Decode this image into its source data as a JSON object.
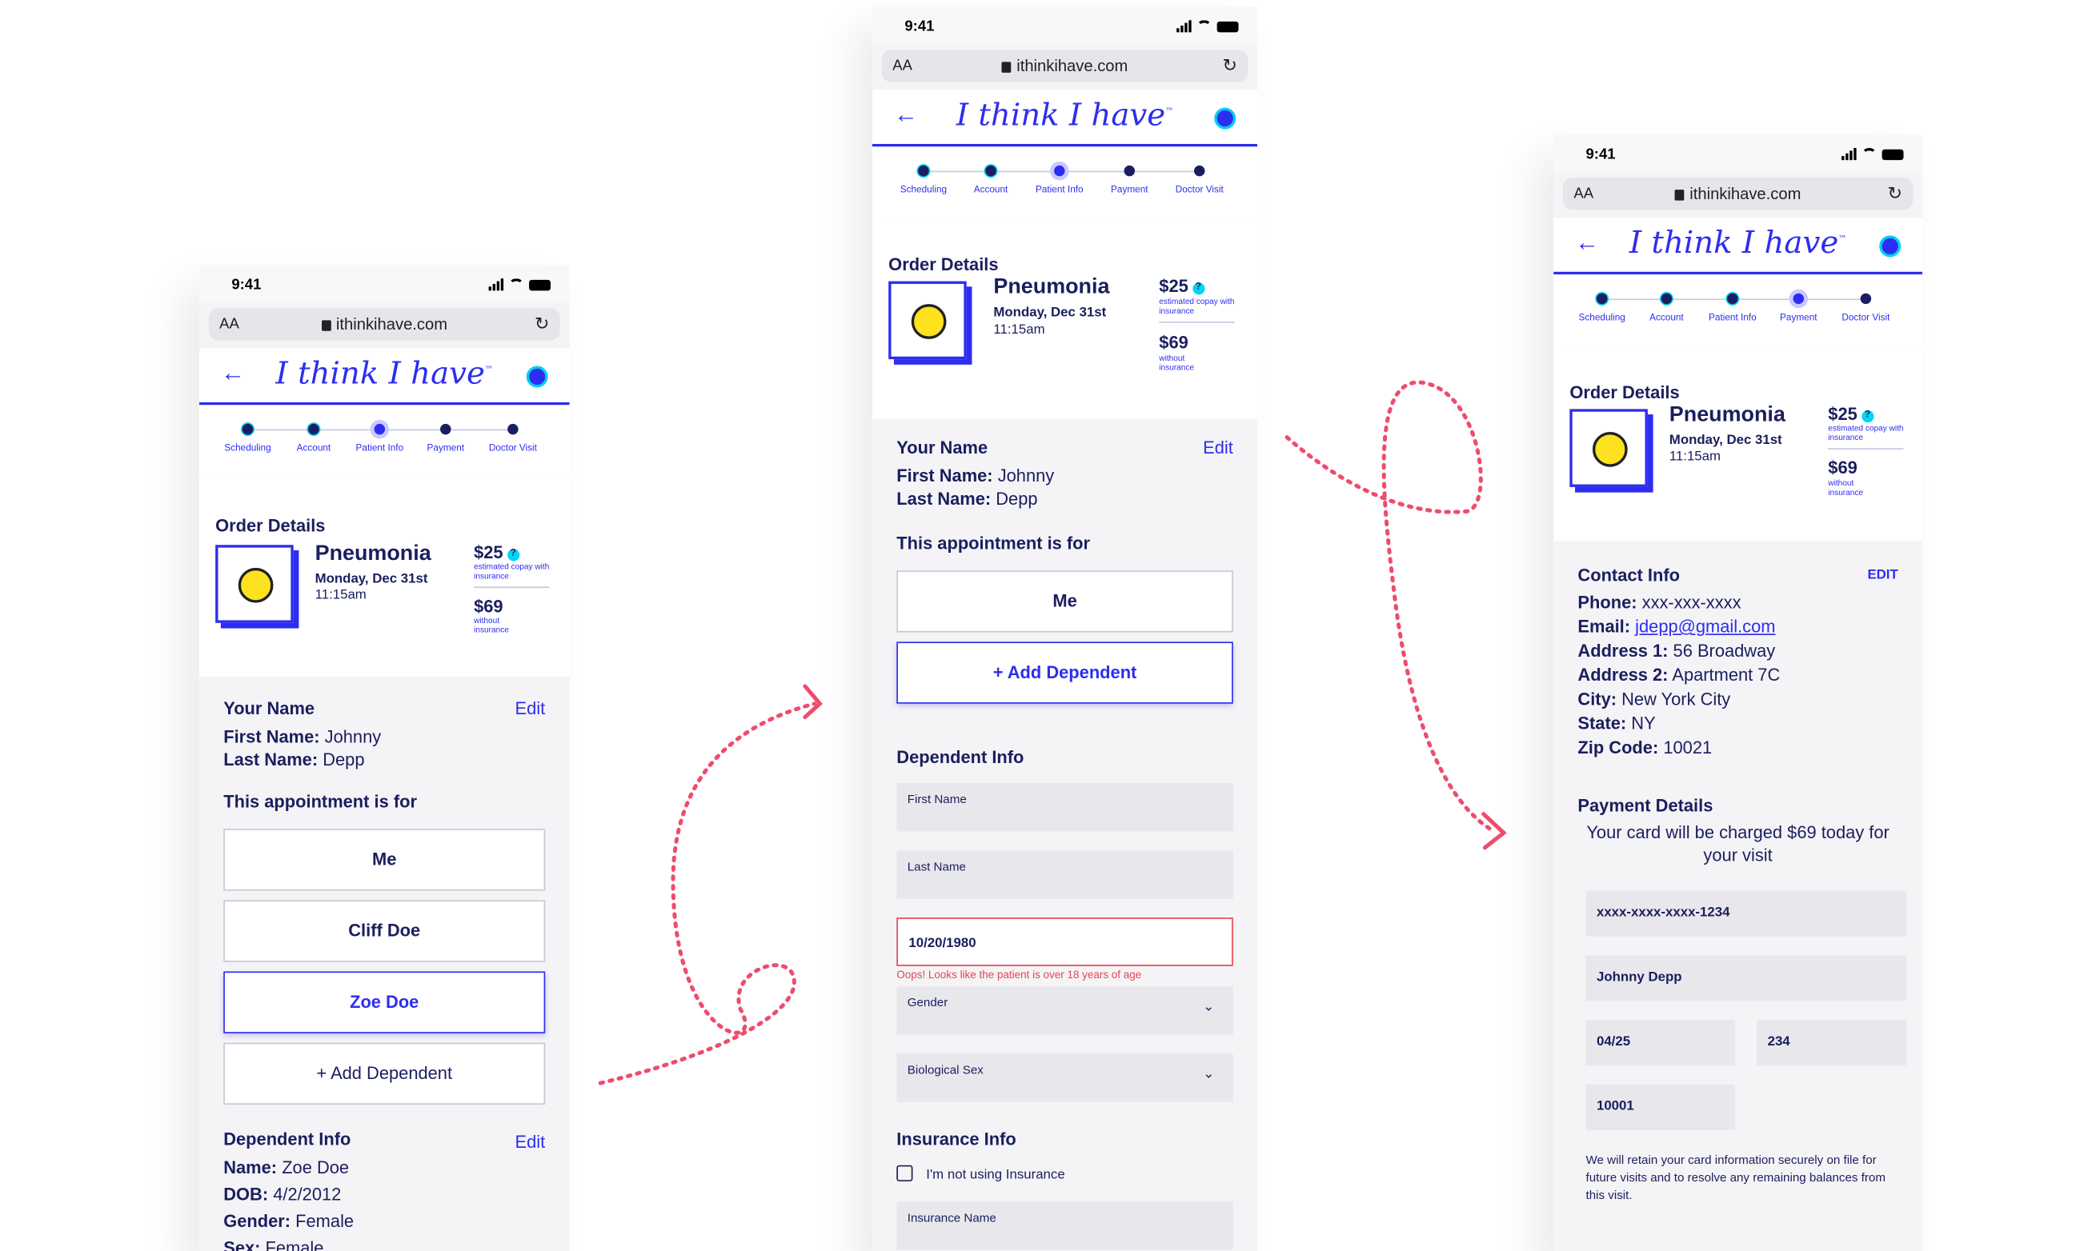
{
  "colors": {
    "accent": "#2d2df0",
    "navy": "#1b1e5e",
    "error": "#e8454e",
    "arrow": "#ef4b6e",
    "highlight": "#00d5f5"
  },
  "common": {
    "time": "9:41",
    "aa": "AA",
    "url": "ithinkihave.com",
    "logo": "I think I have",
    "tm": "™",
    "steps": [
      "Scheduling",
      "Account",
      "Patient Info",
      "Payment",
      "Doctor Visit"
    ],
    "order": {
      "title": "Order Details",
      "condition": "Pneumonia",
      "date": "Monday, Dec 31st",
      "time": "11:15am",
      "price_insured": "$25",
      "price_insured_note": "estimated copay with insurance",
      "price_uninsured": "$69",
      "price_uninsured_note": "without insurance",
      "help": "?"
    }
  },
  "left": {
    "your_name": "Your Name",
    "edit": "Edit",
    "first_label": "First Name:",
    "first_value": "Johnny",
    "last_label": "Last Name:",
    "last_value": "Depp",
    "appt_for": "This appointment is for",
    "options": [
      "Me",
      "Cliff Doe",
      "Zoe Doe",
      "+ Add Dependent"
    ],
    "dependent_title": "Dependent Info",
    "dep_edit": "Edit",
    "dep": [
      {
        "label": "Name:",
        "value": "Zoe Doe"
      },
      {
        "label": "DOB:",
        "value": "4/2/2012"
      },
      {
        "label": "Gender:",
        "value": "Female"
      },
      {
        "label": "Sex:",
        "value": "Female"
      }
    ]
  },
  "middle": {
    "your_name": "Your Name",
    "edit": "Edit",
    "first_label": "First Name:",
    "first_value": "Johnny",
    "last_label": "Last Name:",
    "last_value": "Depp",
    "appt_for": "This appointment is for",
    "options": [
      "Me",
      "+ Add Dependent"
    ],
    "dependent_title": "Dependent Info",
    "first_name_label": "First Name",
    "last_name_label": "Last Name",
    "dob_value": "10/20/1980",
    "dob_error": "Oops! Looks like the patient is over 18 years of age",
    "gender_label": "Gender",
    "sex_label": "Biological Sex",
    "insurance_title": "Insurance Info",
    "no_insurance": "I'm not using Insurance",
    "insurance_name_label": "Insurance Name"
  },
  "right": {
    "contact_title": "Contact Info",
    "edit": "EDIT",
    "contact": [
      {
        "label": "Phone:",
        "value": "xxx-xxx-xxxx"
      },
      {
        "label": "Email:",
        "value": "jdepp@gmail.com"
      },
      {
        "label": "Address 1:",
        "value": "56 Broadway"
      },
      {
        "label": "Address 2:",
        "value": "Apartment 7C"
      },
      {
        "label": "City:",
        "value": "New York City"
      },
      {
        "label": "State:",
        "value": "NY"
      },
      {
        "label": "Zip Code:",
        "value": "10021"
      }
    ],
    "payment_title": "Payment Details",
    "charge_note": "Your card will be charged $69 today for your visit",
    "card_number": "xxxx-xxxx-xxxx-1234",
    "card_name": "Johnny Depp",
    "expiry": "04/25",
    "cvv": "234",
    "zip": "10001",
    "retain_note": "We will retain your card information securely on file for future visits and to resolve any remaining balances from this visit."
  }
}
